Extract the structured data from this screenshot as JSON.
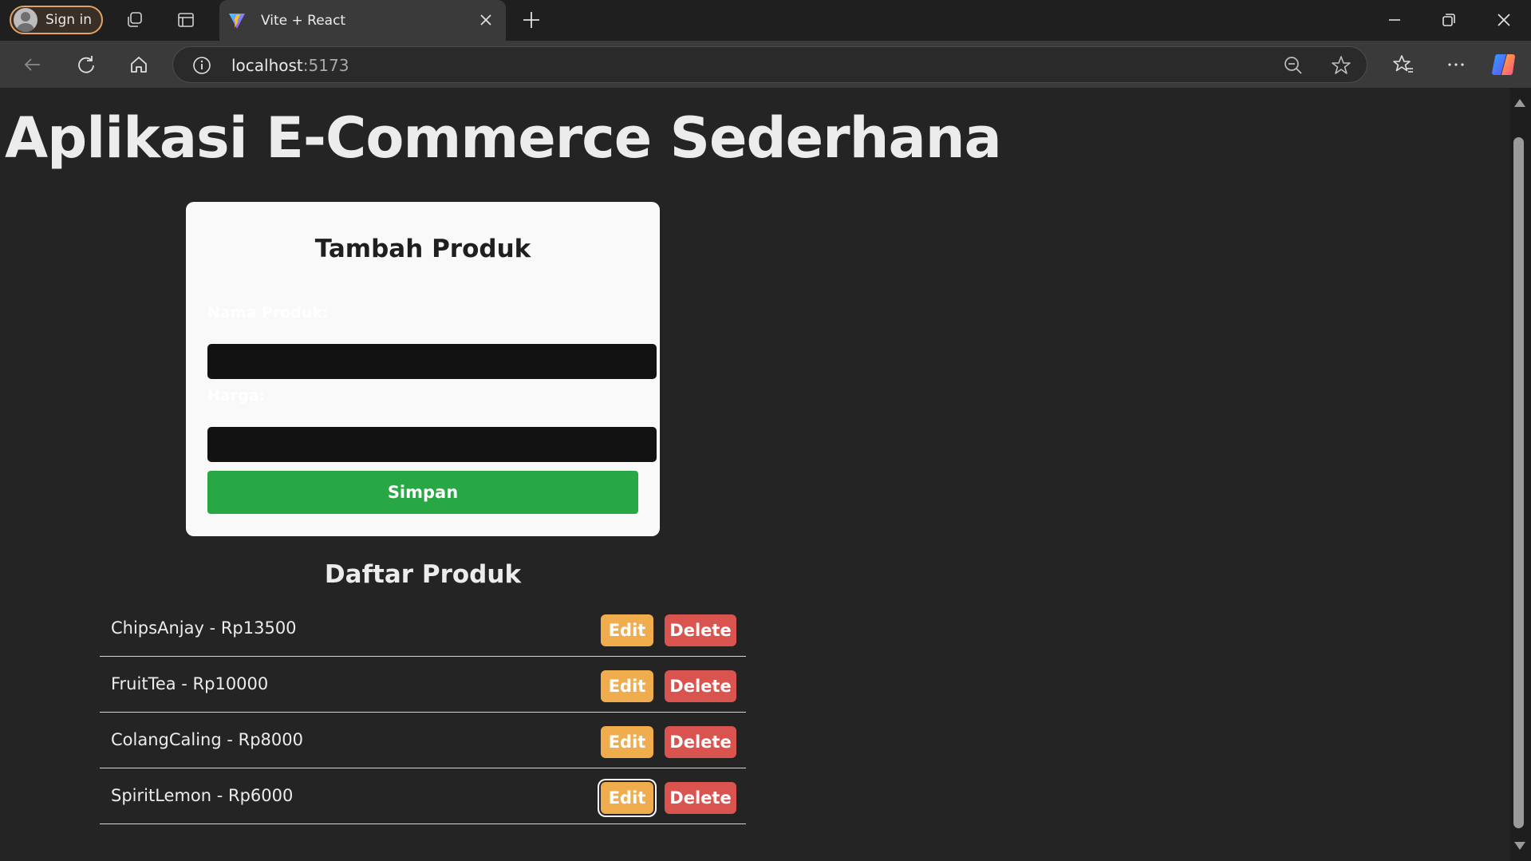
{
  "browser": {
    "signin_label": "Sign in",
    "tab_title": "Vite + React",
    "url_host": "localhost",
    "url_port": ":5173"
  },
  "page": {
    "title": "Aplikasi E-Commerce Sederhana",
    "form": {
      "heading": "Tambah Produk",
      "name_label": "Nama Produk:",
      "name_value": "",
      "price_label": "Harga:",
      "price_value": "",
      "submit_label": "Simpan"
    },
    "list": {
      "heading": "Daftar Produk",
      "items": [
        {
          "text": "ChipsAnjay - Rp13500",
          "edit": "Edit",
          "delete": "Delete"
        },
        {
          "text": "FruitTea - Rp10000",
          "edit": "Edit",
          "delete": "Delete"
        },
        {
          "text": "ColangCaling - Rp8000",
          "edit": "Edit",
          "delete": "Delete"
        },
        {
          "text": "SpiritLemon - Rp6000",
          "edit": "Edit",
          "delete": "Delete"
        }
      ]
    }
  },
  "colors": {
    "background": "#242424",
    "save_button": "#28a745",
    "edit_button": "#f0ad4e",
    "delete_button": "#d9534f",
    "signin_border": "#e0a267"
  },
  "icons": [
    "profile-avatar-icon",
    "workspaces-icon",
    "tab-actions-icon",
    "vite-favicon",
    "close-icon",
    "new-tab-icon",
    "minimize-icon",
    "restore-icon",
    "close-window-icon",
    "back-icon",
    "refresh-icon",
    "home-icon",
    "site-info-icon",
    "zoom-out-icon",
    "favorite-star-icon",
    "favorites-icon",
    "more-icon",
    "copilot-icon"
  ]
}
